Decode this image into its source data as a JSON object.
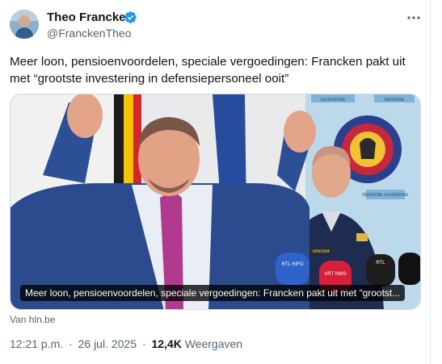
{
  "author": {
    "name": "Theo Francken",
    "handle": "@FranckenTheo",
    "verified": true
  },
  "tweet": {
    "text": "Meer loon, pensioenvoordelen, speciale vergoedingen: Francken pakt uit met “grootste investering in defensiepersoneel ooit”"
  },
  "media": {
    "caption": "Meer loon, pensioenvoordelen, speciale vergoedingen: Francken pakt uit met “grootst...",
    "source": "Van hln.be",
    "photo_text": {
      "banner_top": "LA DÉFENSE",
      "banner_top_2": "DEFENSIE",
      "banner_mid": "DEFENSIE LA DÉFENSE",
      "mic_1": "RTL INFO",
      "mic_2": "VRT NWS",
      "mic_3": "RTL",
      "name_tag": "VANSINA"
    }
  },
  "meta": {
    "time": "12:21 p.m.",
    "separator": "·",
    "date": "26 jul. 2025",
    "views_count": "12,4K",
    "views_label": "Weergaven"
  },
  "colors": {
    "verified": "#1d9bf0",
    "text_primary": "#0f1419",
    "text_secondary": "#536471",
    "border": "#cfd9de"
  },
  "icons": {
    "verified": "verified-badge-icon",
    "more": "more-options-icon"
  }
}
